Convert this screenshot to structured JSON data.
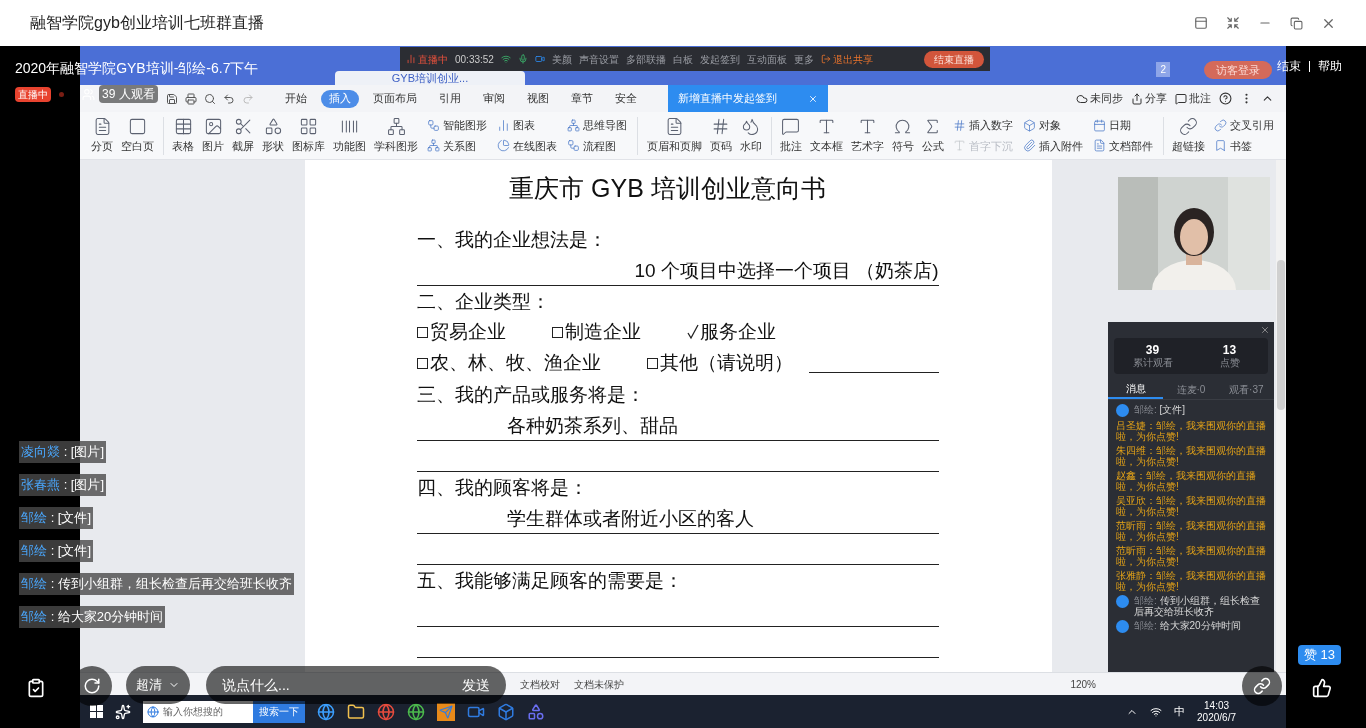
{
  "window": {
    "title": "融智学院gyb创业培训七班群直播"
  },
  "stream": {
    "title": "2020年融智学院GYB培训-邹绘-6.7下午",
    "live_badge": "直播中",
    "viewers": "39 人观看",
    "end": "结束",
    "help": "帮助"
  },
  "control_bar": {
    "live": "直播中",
    "timer": "00:33:52",
    "items": [
      "美颜",
      "声音设置",
      "多部联播",
      "白板",
      "发起签到",
      "互动面板",
      "更多"
    ],
    "exit_share": "退出共享",
    "end_live": "结束直播"
  },
  "wps_tabs": [
    {
      "label": "GYB培训创业...",
      "selected": true
    }
  ],
  "wps_tab_count": "2",
  "guest_login": "访客登录",
  "menu": {
    "tabs": [
      {
        "label": "开始",
        "selected": false
      },
      {
        "label": "插入",
        "selected": true
      },
      {
        "label": "页面布局",
        "selected": false
      },
      {
        "label": "引用",
        "selected": false
      },
      {
        "label": "审阅",
        "selected": false
      },
      {
        "label": "视图",
        "selected": false
      },
      {
        "label": "章节",
        "selected": false
      },
      {
        "label": "安全",
        "selected": false
      }
    ],
    "toast": "新增直播中发起签到",
    "right": [
      "未同步",
      "分享",
      "批注"
    ]
  },
  "ribbon": [
    {
      "kind": "big",
      "label": "分页"
    },
    {
      "kind": "big",
      "label": "空白页"
    },
    {
      "kind": "sep"
    },
    {
      "kind": "big",
      "label": "表格"
    },
    {
      "kind": "big",
      "label": "图片"
    },
    {
      "kind": "big",
      "label": "截屏"
    },
    {
      "kind": "big",
      "label": "形状"
    },
    {
      "kind": "big",
      "label": "图标库"
    },
    {
      "kind": "big",
      "label": "功能图"
    },
    {
      "kind": "big",
      "label": "学科图形"
    },
    {
      "kind": "stack",
      "items": [
        {
          "label": "智能图形",
          "disabled": false
        },
        {
          "label": "关系图",
          "disabled": false
        }
      ]
    },
    {
      "kind": "stack",
      "items": [
        {
          "label": "图表",
          "disabled": false
        },
        {
          "label": "在线图表",
          "disabled": false
        }
      ]
    },
    {
      "kind": "stack",
      "items": [
        {
          "label": "思维导图",
          "disabled": false
        },
        {
          "label": "流程图",
          "disabled": false
        }
      ]
    },
    {
      "kind": "sep"
    },
    {
      "kind": "big",
      "label": "页眉和页脚"
    },
    {
      "kind": "big",
      "label": "页码"
    },
    {
      "kind": "big",
      "label": "水印"
    },
    {
      "kind": "sep"
    },
    {
      "kind": "big",
      "label": "批注"
    },
    {
      "kind": "big",
      "label": "文本框"
    },
    {
      "kind": "big",
      "label": "艺术字"
    },
    {
      "kind": "big",
      "label": "符号"
    },
    {
      "kind": "big",
      "label": "公式"
    },
    {
      "kind": "stack",
      "items": [
        {
          "label": "插入数字",
          "disabled": false
        },
        {
          "label": "首字下沉",
          "disabled": true
        }
      ]
    },
    {
      "kind": "stack",
      "items": [
        {
          "label": "对象",
          "disabled": false
        },
        {
          "label": "插入附件",
          "disabled": false
        }
      ]
    },
    {
      "kind": "stack",
      "items": [
        {
          "label": "日期",
          "disabled": false
        },
        {
          "label": "文档部件",
          "disabled": false
        }
      ]
    },
    {
      "kind": "sep"
    },
    {
      "kind": "big",
      "label": "超链接"
    },
    {
      "kind": "stack",
      "items": [
        {
          "label": "交叉引用",
          "disabled": false
        },
        {
          "label": "书签",
          "disabled": false
        }
      ]
    }
  ],
  "document": {
    "title": "重庆市 GYB 培训创业意向书",
    "lines": [
      {
        "kind": "heading",
        "text": "一、我的企业想法是："
      },
      {
        "kind": "trailing",
        "text": "10 个项目中选择一个项目 （奶茶店)"
      },
      {
        "kind": "heading",
        "text": "二、企业类型："
      },
      {
        "kind": "checks",
        "blank": false,
        "options": [
          {
            "label": "贸易企业",
            "checked": false
          },
          {
            "label": "制造企业",
            "checked": false
          },
          {
            "label": "服务企业",
            "checked": true
          }
        ]
      },
      {
        "kind": "checks",
        "blank": true,
        "options": [
          {
            "label": "农、林、牧、渔企业",
            "checked": false
          },
          {
            "label": "其他（请说明）",
            "checked": false
          }
        ]
      },
      {
        "kind": "heading",
        "text": "三、我的产品或服务将是："
      },
      {
        "kind": "answer",
        "text": "各种奶茶系列、甜品"
      },
      {
        "kind": "line"
      },
      {
        "kind": "heading",
        "text": "四、我的顾客将是："
      },
      {
        "kind": "answer",
        "text": "学生群体或者附近小区的客人"
      },
      {
        "kind": "line"
      },
      {
        "kind": "heading",
        "text": "五、我能够满足顾客的需要是："
      },
      {
        "kind": "line"
      },
      {
        "kind": "line"
      }
    ]
  },
  "chat_panel": {
    "stats": [
      {
        "value": "39",
        "label": "累计观看"
      },
      {
        "value": "13",
        "label": "点赞"
      }
    ],
    "tabs": [
      {
        "label": "消息",
        "selected": true
      },
      {
        "label": "连麦·0",
        "selected": false
      },
      {
        "label": "观看·37",
        "selected": false
      }
    ],
    "messages": [
      {
        "kind": "host",
        "name": "邹绘:",
        "text": "[文件]"
      },
      {
        "kind": "like",
        "name": "吕圣婕：",
        "text": "邹绘，我来围观你的直播啦，为你点赞!"
      },
      {
        "kind": "like",
        "name": "朱四维：",
        "text": "邹绘，我来围观你的直播啦，为你点赞!"
      },
      {
        "kind": "like",
        "name": "赵鑫：",
        "text": "邹绘，我来围观你的直播啦，为你点赞!"
      },
      {
        "kind": "like",
        "name": "吴亚欣：",
        "text": "邹绘，我来围观你的直播啦，为你点赞!"
      },
      {
        "kind": "like",
        "name": "范昕雨：",
        "text": "邹绘，我来围观你的直播啦，为你点赞!"
      },
      {
        "kind": "like",
        "name": "范昕雨：",
        "text": "邹绘，我来围观你的直播啦，为你点赞!"
      },
      {
        "kind": "like",
        "name": "张雅静：",
        "text": "邹绘，我来围观你的直播啦，为你点赞!"
      },
      {
        "kind": "host",
        "name": "邹绘:",
        "text": "传到小组群，组长检查后再交给班长收齐"
      },
      {
        "kind": "host",
        "name": "邹绘:",
        "text": "给大家20分钟时间"
      }
    ]
  },
  "overlay_chat": [
    {
      "name": "凌向燚",
      "text": ": [图片]"
    },
    {
      "name": "张春燕",
      "text": ": [图片]"
    },
    {
      "name": "邹绘",
      "text": ": [文件]"
    },
    {
      "name": "邹绘",
      "text": ": [文件]"
    },
    {
      "name": "邹绘",
      "text": ": 传到小组群，组长检查后再交给班长收齐"
    },
    {
      "name": "邹绘",
      "text": ": 给大家20分钟时间"
    }
  ],
  "status_bar": {
    "items": [
      "文档校对",
      "文档未保护"
    ],
    "zoom": "120%"
  },
  "live_controls": {
    "quality": "超清",
    "comment_placeholder": "说点什么...",
    "send": "发送",
    "likes": "赞 13"
  },
  "taskbar": {
    "search_placeholder": "输入你想搜的",
    "search_button": "搜索一下",
    "ime": "中",
    "time": "14:03",
    "date": "2020/6/7"
  }
}
